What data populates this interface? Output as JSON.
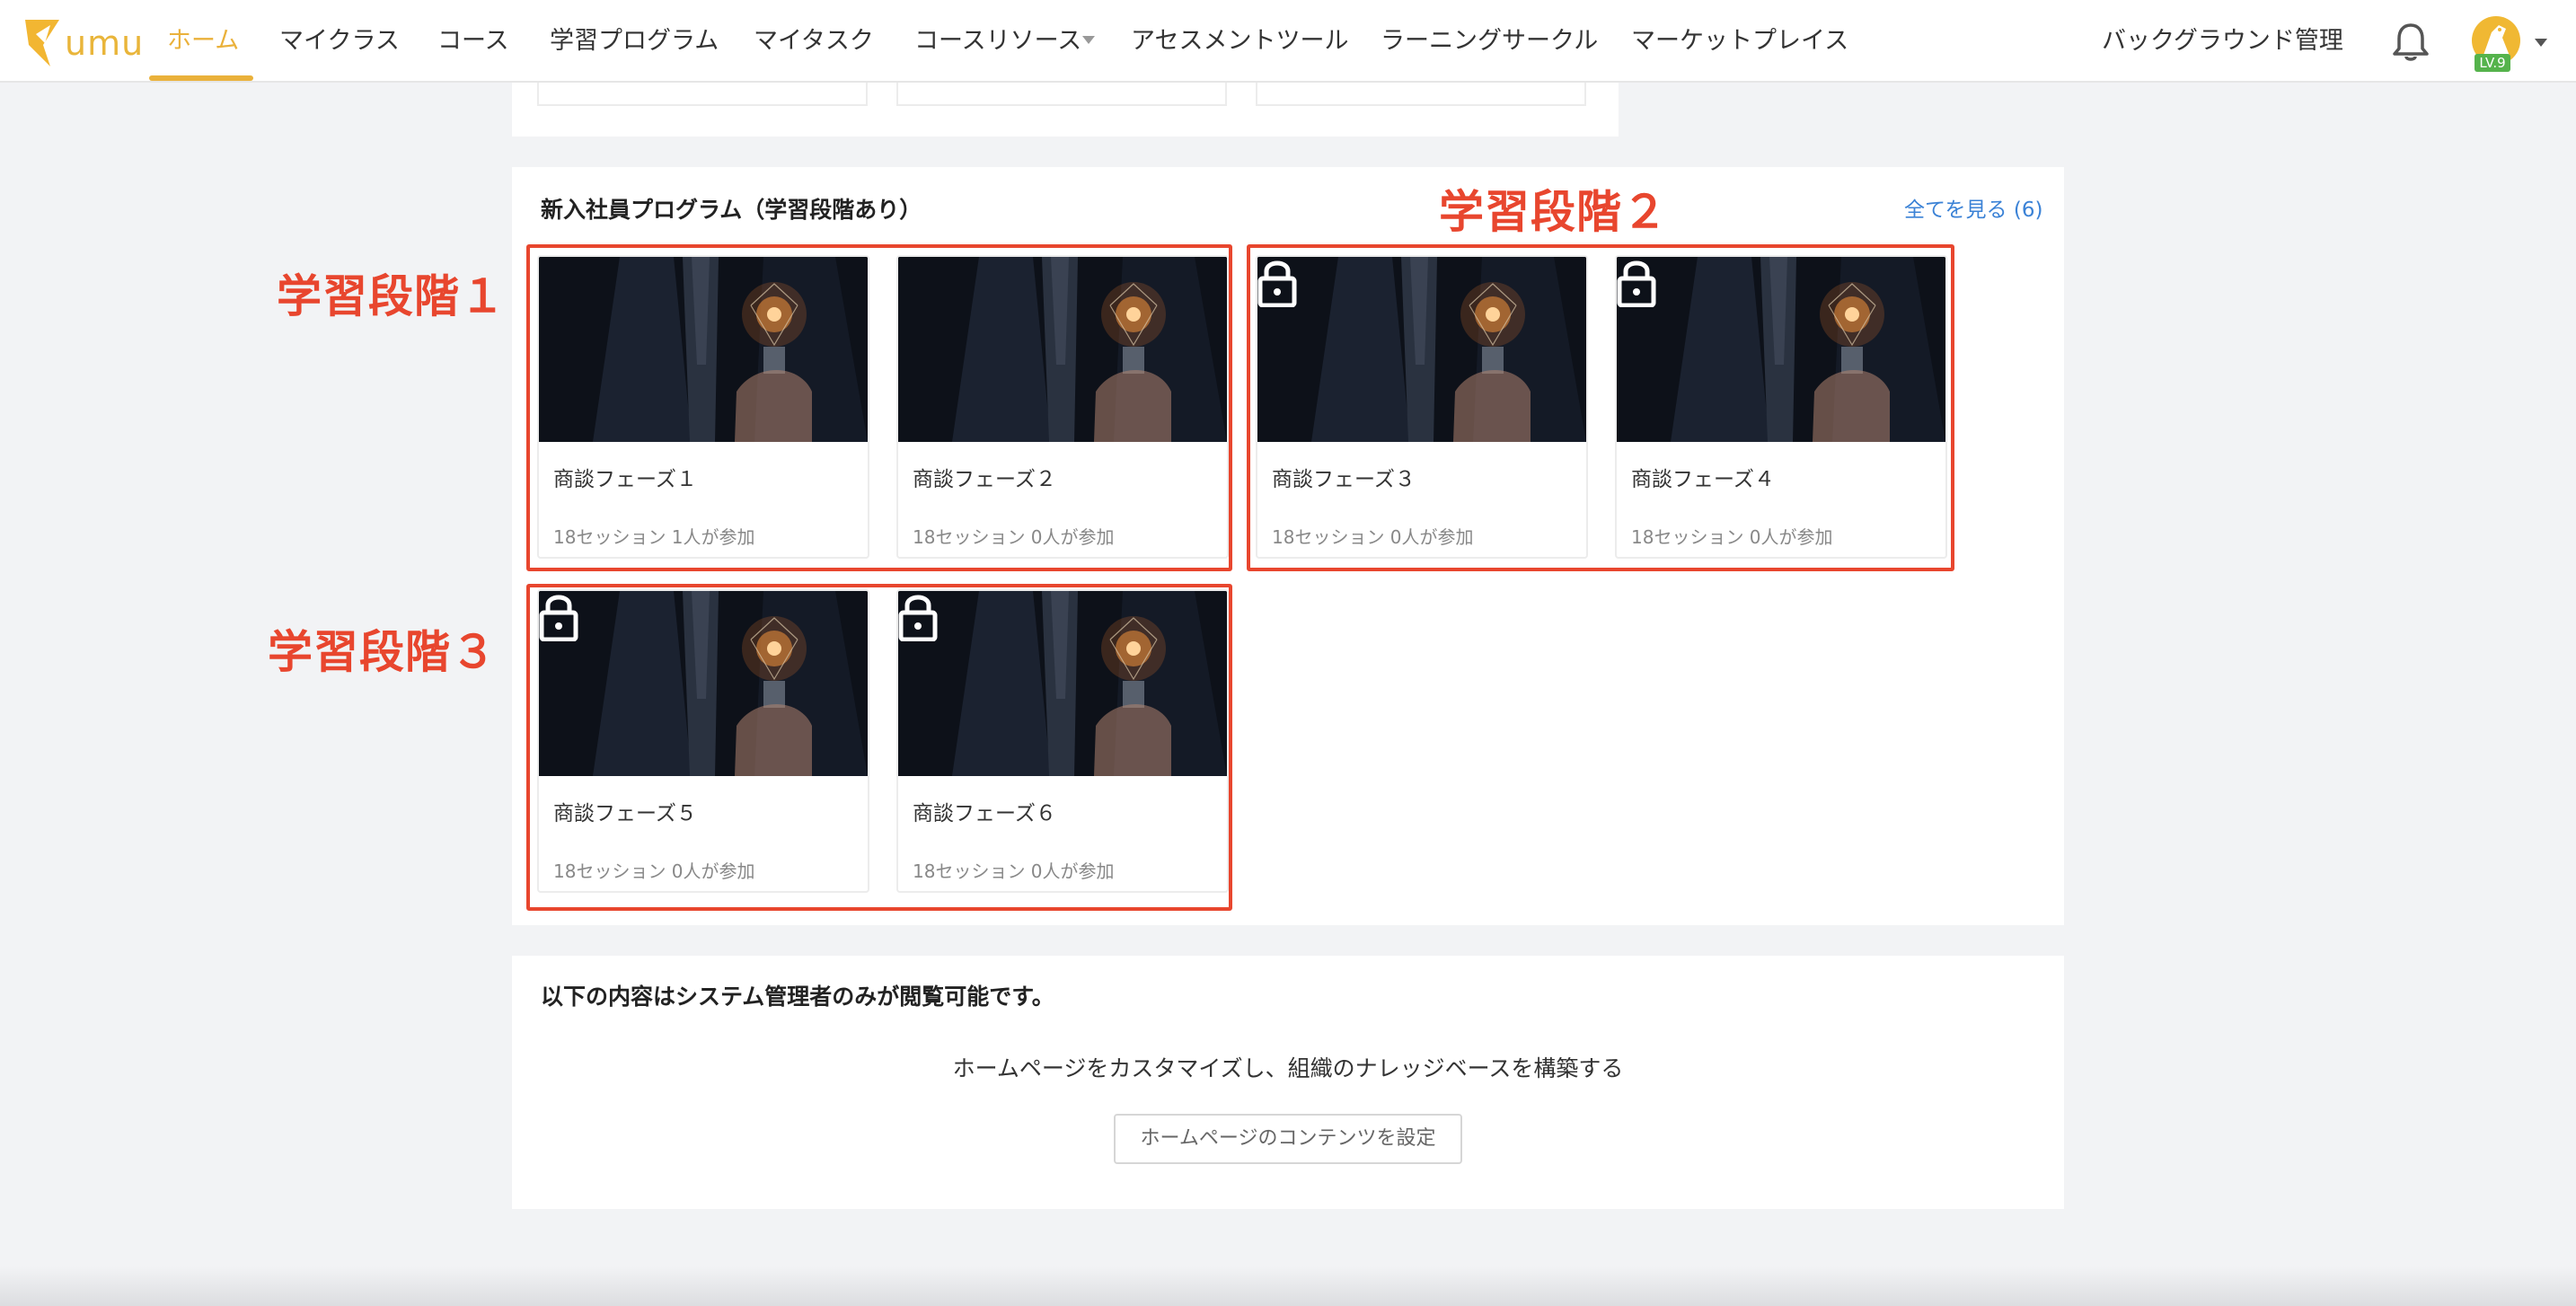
{
  "nav": {
    "logo_text": "umu",
    "items": [
      {
        "label": "ホーム",
        "active": true
      },
      {
        "label": "マイクラス"
      },
      {
        "label": "コース"
      },
      {
        "label": "学習プログラム"
      },
      {
        "label": "マイタスク"
      },
      {
        "label": "コースリソース"
      },
      {
        "label": "アセスメントツール"
      },
      {
        "label": "ラーニングサークル"
      },
      {
        "label": "マーケットプレイス"
      }
    ],
    "admin_link": "バックグラウンド管理",
    "level_badge": "LV.9",
    "icons": [
      "bell-icon",
      "avatar",
      "chevron-down-icon"
    ]
  },
  "program": {
    "title": "新入社員プログラム（学習段階あり）",
    "view_all": "全てを見る (6)",
    "cards": [
      {
        "title": "商談フェーズ１",
        "meta": "18セッション 1人が参加",
        "locked": false
      },
      {
        "title": "商談フェーズ２",
        "meta": "18セッション 0人が参加",
        "locked": false
      },
      {
        "title": "商談フェーズ３",
        "meta": "18セッション 0人が参加",
        "locked": true
      },
      {
        "title": "商談フェーズ４",
        "meta": "18セッション 0人が参加",
        "locked": true
      },
      {
        "title": "商談フェーズ５",
        "meta": "18セッション 0人が参加",
        "locked": true
      },
      {
        "title": "商談フェーズ６",
        "meta": "18セッション 0人が参加",
        "locked": true
      }
    ]
  },
  "annotations": {
    "stage1": "学習段階１",
    "stage2": "学習段階２",
    "stage3": "学習段階３",
    "color": "#e8462e"
  },
  "admin": {
    "note": "以下の内容はシステム管理者のみが閲覧可能です。",
    "description": "ホームページをカスタマイズし、組織のナレッジベースを構築する",
    "button": "ホームページのコンテンツを設定"
  },
  "colors": {
    "accent": "#eab13b",
    "link": "#3b82d6",
    "level_badge": "#55b34c"
  }
}
